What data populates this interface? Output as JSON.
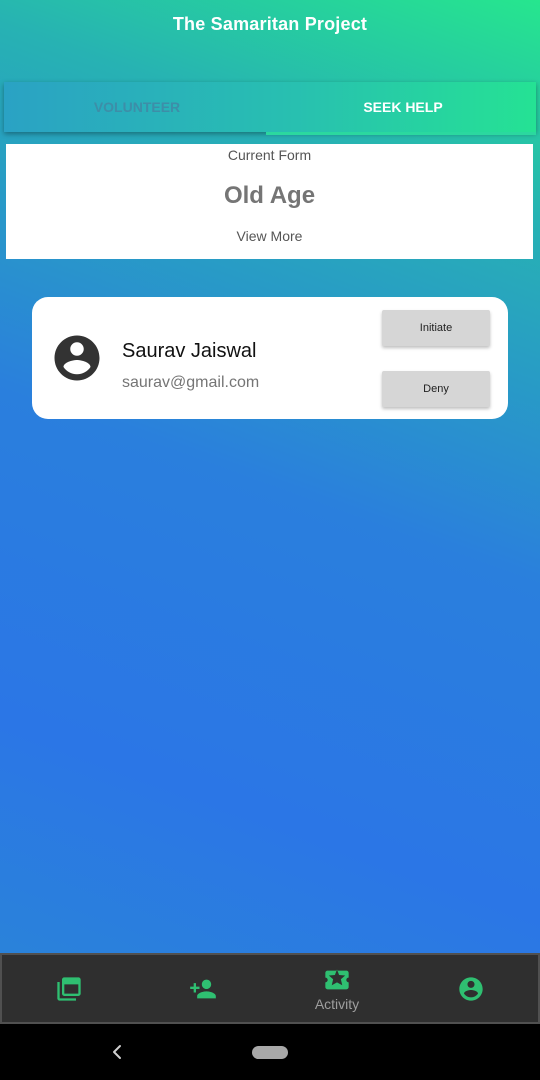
{
  "app": {
    "title": "The Samaritan Project"
  },
  "tabs": [
    {
      "label": "VOLUNTEER",
      "active": false
    },
    {
      "label": "SEEK HELP",
      "active": true
    }
  ],
  "current_form": {
    "caption": "Current Form",
    "name": "Old Age",
    "view_more": "View More"
  },
  "request": {
    "avatar_icon": "account-circle-icon",
    "name": "Saurav Jaiswal",
    "email": "saurav@gmail.com",
    "initiate_label": "Initiate",
    "deny_label": "Deny"
  },
  "bottom_nav": {
    "items": [
      {
        "icon": "collections-icon",
        "label": ""
      },
      {
        "icon": "person-add-icon",
        "label": ""
      },
      {
        "icon": "ticket-star-icon",
        "label": "Activity",
        "selected": true
      },
      {
        "icon": "account-circle-icon",
        "label": ""
      }
    ]
  },
  "colors": {
    "accent_green": "#2fbf71",
    "gradient_top": "#26e68e",
    "gradient_mid": "#2a7fdd",
    "nav_background": "#2f2f2f",
    "button_gray": "#d6d6d6"
  }
}
